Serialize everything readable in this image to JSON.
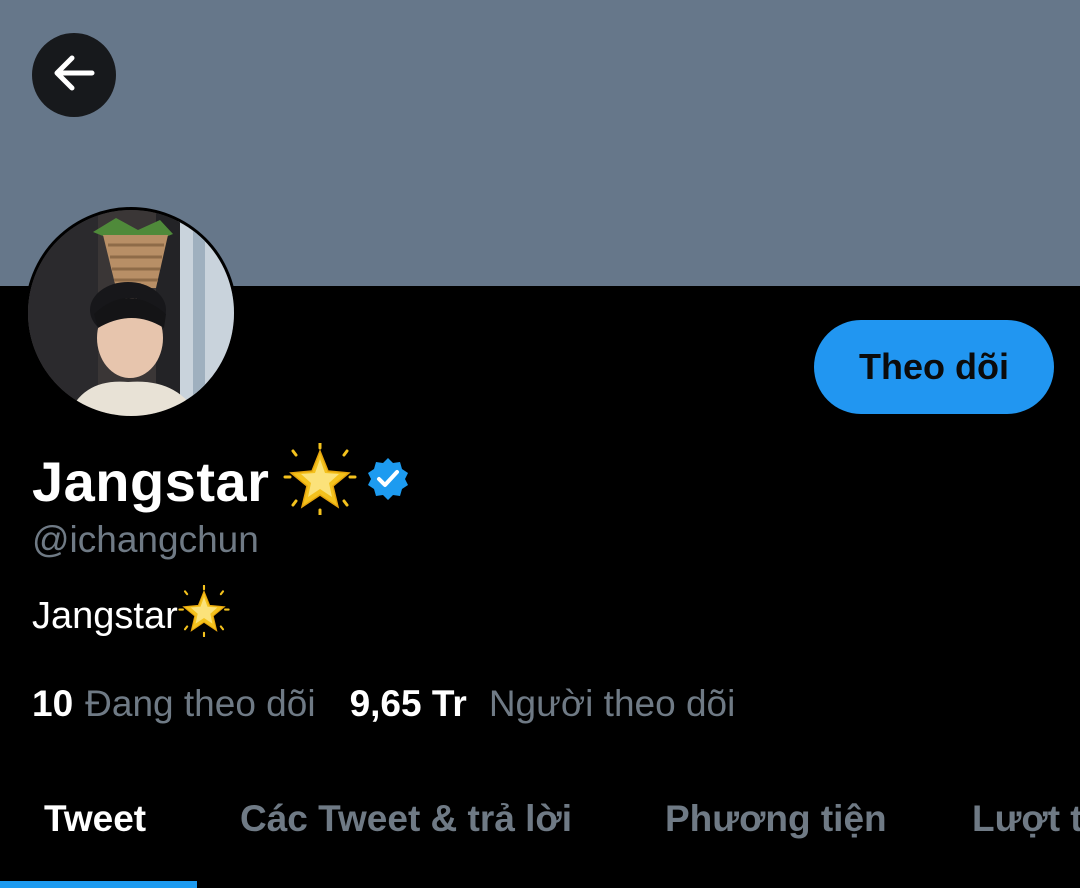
{
  "colors": {
    "banner": "#66778a",
    "background": "#000000",
    "accent": "#1d9bf0",
    "follow_button": "#2196f1",
    "muted_text": "#6f7a85"
  },
  "header": {
    "back_icon": "arrow-left-icon"
  },
  "profile": {
    "avatar_icon": "profile-photo",
    "follow_label": "Theo dõi",
    "display_name": "Jangstar",
    "name_emoji": "star-sparkle-icon",
    "verified_icon": "verified-badge-icon",
    "handle": "@ichangchun",
    "bio": "Jangstar"
  },
  "stats": {
    "following_count": "10",
    "following_label": "Đang theo dõi",
    "followers_count": "9,65 Tr",
    "followers_label": "Người theo dõi"
  },
  "tabs": [
    {
      "label": "Tweet",
      "active": true
    },
    {
      "label": "Các Tweet & trả lời",
      "active": false
    },
    {
      "label": "Phương tiện",
      "active": false
    },
    {
      "label": "Lượt thích",
      "active": false
    }
  ]
}
